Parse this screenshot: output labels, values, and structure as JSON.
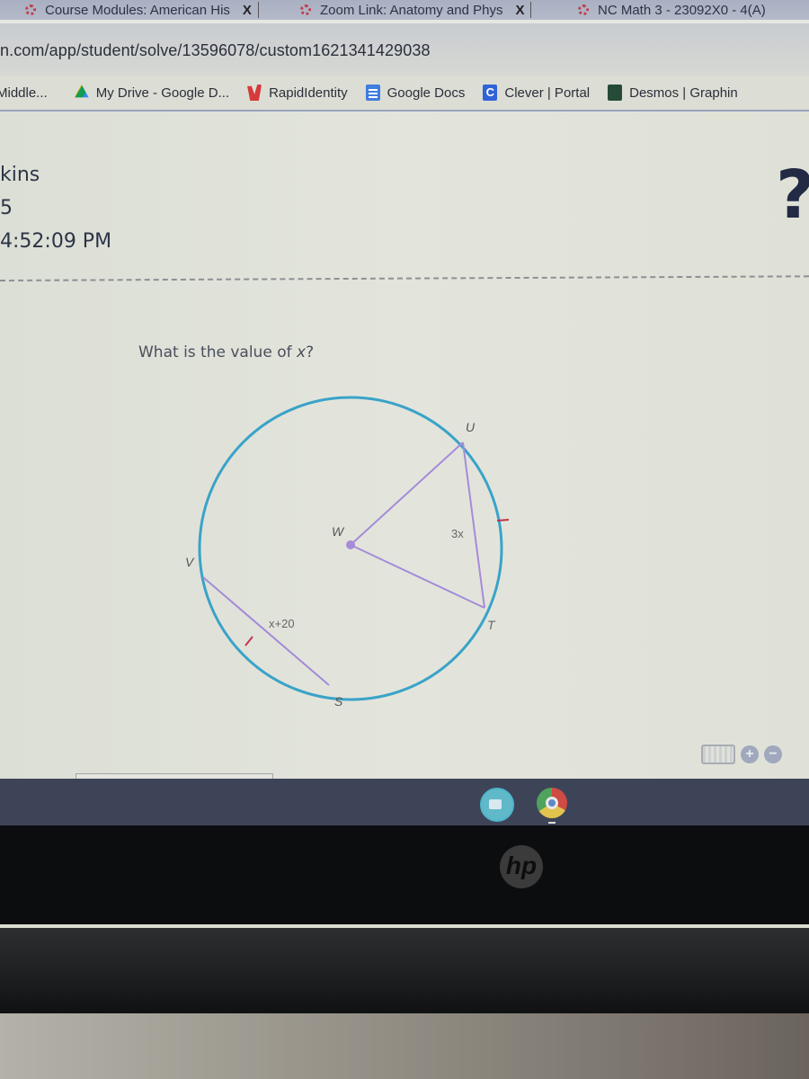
{
  "browser": {
    "tabs": [
      {
        "title": "Course Modules: American His",
        "close": "X"
      },
      {
        "title": "Zoom Link: Anatomy and Phys",
        "close": "X"
      },
      {
        "title": "NC Math 3 - 23092X0 - 4(A)"
      }
    ],
    "url": "n.com/app/student/solve/13596078/custom1621341429038",
    "bookmarks": [
      {
        "label": "Middle...",
        "icon": "school-icon"
      },
      {
        "label": "My Drive - Google D...",
        "icon": "google-drive-icon"
      },
      {
        "label": "RapidIdentity",
        "icon": "rapididentity-icon"
      },
      {
        "label": "Google Docs",
        "icon": "google-docs-icon"
      },
      {
        "label": "Clever | Portal",
        "icon": "clever-icon",
        "glyph": "C"
      },
      {
        "label": "Desmos | Graphin",
        "icon": "desmos-icon"
      }
    ]
  },
  "student": {
    "name": "kins",
    "score": "5",
    "time": "4:52:09 PM"
  },
  "help_glyph": "?",
  "question": {
    "prefix": "What is the value of ",
    "variable": "x",
    "suffix": "?"
  },
  "diagram": {
    "center_label": "W",
    "points": {
      "U": "U",
      "T": "T",
      "V": "V",
      "S": "S"
    },
    "chord_UT_label": "3x",
    "chord_VS_label": "x+20",
    "circle_color": "#3aa3c8",
    "segment_color": "#a58bd8",
    "tick_color": "#c2354d"
  },
  "page_tools": {
    "zoom_in": "+",
    "zoom_out": "−"
  },
  "shelf": {
    "apps": [
      "zoom-app",
      "chrome-app"
    ]
  },
  "laptop": {
    "logo": "hp"
  }
}
